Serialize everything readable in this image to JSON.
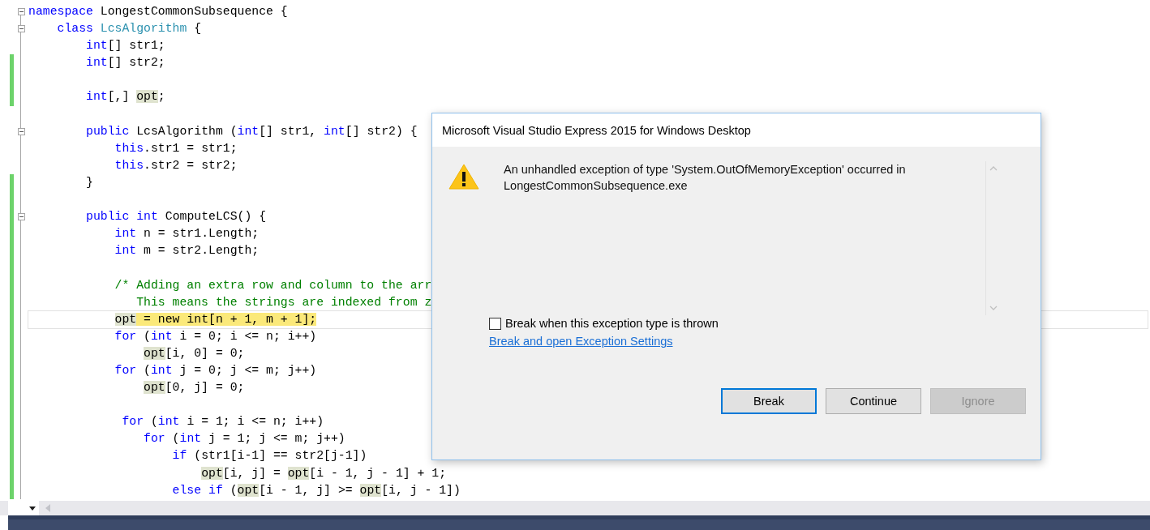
{
  "editor": {
    "lines": [
      {
        "fold": true,
        "changed": false,
        "current": false,
        "tokens": [
          {
            "kind": "kw",
            "text": "namespace"
          },
          {
            "kind": "plain",
            "text": " LongestCommonSubsequence {"
          }
        ]
      },
      {
        "fold": true,
        "changed": false,
        "current": false,
        "tokens": [
          {
            "kind": "kw",
            "text": "    class"
          },
          {
            "kind": "type",
            "text": " LcsAlgorithm"
          },
          {
            "kind": "plain",
            "text": " {"
          }
        ]
      },
      {
        "fold": false,
        "changed": false,
        "current": false,
        "tokens": [
          {
            "kind": "kw",
            "text": "        int"
          },
          {
            "kind": "plain",
            "text": "[] str1;"
          }
        ]
      },
      {
        "fold": false,
        "changed": true,
        "current": false,
        "tokens": [
          {
            "kind": "kw",
            "text": "        int"
          },
          {
            "kind": "plain",
            "text": "[] str2;"
          }
        ]
      },
      {
        "fold": false,
        "changed": true,
        "current": false
      },
      {
        "fold": false,
        "changed": true,
        "current": false,
        "tokens": [
          {
            "kind": "kw",
            "text": "        int"
          },
          {
            "kind": "plain",
            "text": "[,] "
          },
          {
            "kind": "ref",
            "text": "opt"
          },
          {
            "kind": "plain",
            "text": ";"
          }
        ]
      },
      {
        "fold": false,
        "changed": false,
        "current": false
      },
      {
        "fold": true,
        "changed": false,
        "current": false,
        "tokens": [
          {
            "kind": "kw",
            "text": "        public"
          },
          {
            "kind": "plain",
            "text": " LcsAlgorithm ("
          },
          {
            "kind": "kw",
            "text": "int"
          },
          {
            "kind": "plain",
            "text": "[] str1, "
          },
          {
            "kind": "kw",
            "text": "int"
          },
          {
            "kind": "plain",
            "text": "[] str2) {"
          }
        ]
      },
      {
        "fold": false,
        "changed": false,
        "current": false,
        "tokens": [
          {
            "kind": "kw",
            "text": "            this"
          },
          {
            "kind": "plain",
            "text": ".str1 = str1;"
          }
        ]
      },
      {
        "fold": false,
        "changed": false,
        "current": false,
        "tokens": [
          {
            "kind": "kw",
            "text": "            this"
          },
          {
            "kind": "plain",
            "text": ".str2 = str2;"
          }
        ]
      },
      {
        "fold": false,
        "changed": true,
        "current": false,
        "tokens": [
          {
            "kind": "plain",
            "text": "        }"
          }
        ]
      },
      {
        "fold": false,
        "changed": true,
        "current": false
      },
      {
        "fold": true,
        "changed": true,
        "current": false,
        "tokens": [
          {
            "kind": "kw",
            "text": "        public"
          },
          {
            "kind": "kw",
            "text": " int"
          },
          {
            "kind": "plain",
            "text": " ComputeLCS() {"
          }
        ]
      },
      {
        "fold": false,
        "changed": true,
        "current": false,
        "tokens": [
          {
            "kind": "kw",
            "text": "            int"
          },
          {
            "kind": "plain",
            "text": " n = str1.Length;"
          }
        ]
      },
      {
        "fold": false,
        "changed": true,
        "current": false,
        "tokens": [
          {
            "kind": "kw",
            "text": "            int"
          },
          {
            "kind": "plain",
            "text": " m = str2.Length;"
          }
        ]
      },
      {
        "fold": false,
        "changed": true,
        "current": false
      },
      {
        "fold": false,
        "changed": true,
        "current": false,
        "tokens": [
          {
            "kind": "comment",
            "text": "            /* Adding an extra row and column to the arr"
          }
        ]
      },
      {
        "fold": false,
        "changed": true,
        "current": false,
        "tokens": [
          {
            "kind": "comment",
            "text": "               This means the strings are indexed from z"
          }
        ]
      },
      {
        "fold": false,
        "changed": true,
        "current": true,
        "tokens": [
          {
            "kind": "ref",
            "text": "            opt"
          },
          {
            "kind": "plain",
            "text": " = new int[n + 1, m + 1];"
          }
        ]
      },
      {
        "fold": false,
        "changed": true,
        "current": false,
        "tokens": [
          {
            "kind": "kw",
            "text": "            for"
          },
          {
            "kind": "plain",
            "text": " ("
          },
          {
            "kind": "kw",
            "text": "int"
          },
          {
            "kind": "plain",
            "text": " i = 0; i <= n; i++)"
          }
        ]
      },
      {
        "fold": false,
        "changed": true,
        "current": false,
        "tokens": [
          {
            "kind": "ref",
            "text": "                opt"
          },
          {
            "kind": "plain",
            "text": "[i, 0] = 0;"
          }
        ]
      },
      {
        "fold": false,
        "changed": true,
        "current": false,
        "tokens": [
          {
            "kind": "kw",
            "text": "            for"
          },
          {
            "kind": "plain",
            "text": " ("
          },
          {
            "kind": "kw",
            "text": "int"
          },
          {
            "kind": "plain",
            "text": " j = 0; j <= m; j++)"
          }
        ]
      },
      {
        "fold": false,
        "changed": true,
        "current": false,
        "tokens": [
          {
            "kind": "ref",
            "text": "                opt"
          },
          {
            "kind": "plain",
            "text": "[0, j] = 0;"
          }
        ]
      },
      {
        "fold": false,
        "changed": true,
        "current": false
      },
      {
        "fold": false,
        "changed": true,
        "current": false,
        "tokens": [
          {
            "kind": "kw",
            "text": "             for"
          },
          {
            "kind": "plain",
            "text": " ("
          },
          {
            "kind": "kw",
            "text": "int"
          },
          {
            "kind": "plain",
            "text": " i = 1; i <= n; i++)"
          }
        ]
      },
      {
        "fold": false,
        "changed": true,
        "current": false,
        "tokens": [
          {
            "kind": "kw",
            "text": "                for"
          },
          {
            "kind": "plain",
            "text": " ("
          },
          {
            "kind": "kw",
            "text": "int"
          },
          {
            "kind": "plain",
            "text": " j = 1; j <= m; j++)"
          }
        ]
      },
      {
        "fold": false,
        "changed": true,
        "current": false,
        "tokens": [
          {
            "kind": "kw",
            "text": "                    if"
          },
          {
            "kind": "plain",
            "text": " (str1[i-1] == str2[j-1])"
          }
        ]
      },
      {
        "fold": false,
        "changed": true,
        "current": false,
        "tokens": [
          {
            "kind": "ref",
            "text": "                        opt"
          },
          {
            "kind": "plain",
            "text": "[i, j] = "
          },
          {
            "kind": "ref",
            "text": "opt"
          },
          {
            "kind": "plain",
            "text": "[i - 1, j - 1] + 1;"
          }
        ]
      },
      {
        "fold": false,
        "changed": true,
        "current": false,
        "tokens": [
          {
            "kind": "kw",
            "text": "                    else"
          },
          {
            "kind": "kw",
            "text": " if"
          },
          {
            "kind": "plain",
            "text": " ("
          },
          {
            "kind": "ref",
            "text": "opt"
          },
          {
            "kind": "plain",
            "text": "[i - 1, j] >= "
          },
          {
            "kind": "ref",
            "text": "opt"
          },
          {
            "kind": "plain",
            "text": "[i, j - 1])"
          }
        ]
      }
    ]
  },
  "dialog": {
    "title": "Microsoft Visual Studio Express 2015 for Windows Desktop",
    "message": "An unhandled exception of type 'System.OutOfMemoryException' occurred in LongestCommonSubsequence.exe",
    "checkbox": {
      "label": "Break when this exception type is thrown",
      "checked": false
    },
    "link": "Break and open Exception Settings",
    "buttons": [
      {
        "label": "Break",
        "default": true,
        "disabled": false
      },
      {
        "label": "Continue",
        "default": false,
        "disabled": false
      },
      {
        "label": "Ignore",
        "default": false,
        "disabled": true
      }
    ]
  }
}
